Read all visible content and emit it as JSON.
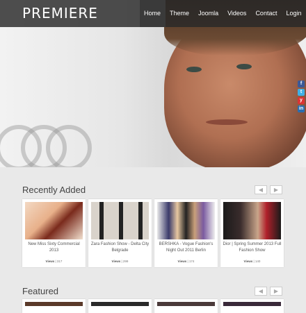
{
  "site": {
    "logo": "PREMIERE"
  },
  "nav": {
    "items": [
      "Home",
      "Theme",
      "Joomla",
      "Videos",
      "Contact",
      "Login"
    ],
    "active": "Home"
  },
  "social": [
    "f",
    "t",
    "y",
    "in"
  ],
  "recent": {
    "title": "Recently Added",
    "prev_arrow": "◀",
    "next_arrow": "▶",
    "items": [
      {
        "title": "New Miss Sixty Commercial 2013",
        "views_label": "Views",
        "views": "| 317"
      },
      {
        "title": "Zara Fashion Show - Delta City Belgrade",
        "views_label": "Views",
        "views": "| 299"
      },
      {
        "title": "BERSHKA - Vogue Fashion's Night Out 2011 Berlin",
        "views_label": "Views",
        "views": "| 174"
      },
      {
        "title": "Dior | Spring Summer 2013 Full Fashion Show",
        "views_label": "Views",
        "views": "| 140"
      }
    ]
  },
  "featured": {
    "title": "Featured",
    "prev_arrow": "◀",
    "next_arrow": "▶"
  },
  "colors": {
    "header_bg": "#282828",
    "page_bg": "#e9e9e9",
    "card_bg": "#ffffff"
  }
}
